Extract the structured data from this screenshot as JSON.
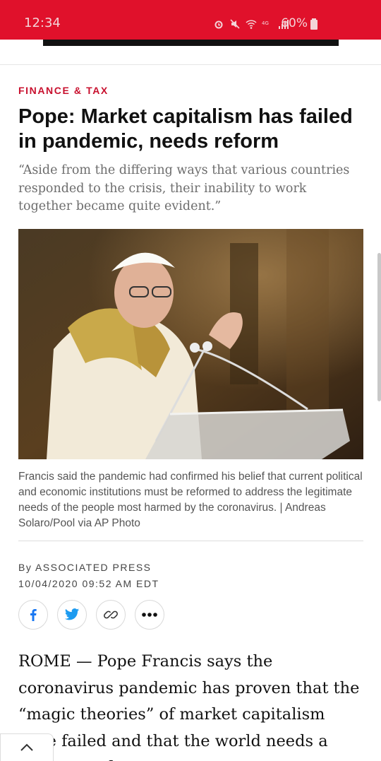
{
  "status_bar": {
    "time": "12:34",
    "battery": "60%",
    "icons": [
      "alarm-icon",
      "mute-icon",
      "wifi-icon",
      "lte-icon",
      "signal-icon",
      "battery-icon"
    ],
    "color": "#e0112b"
  },
  "article": {
    "category": "FINANCE & TAX",
    "headline": "Pope: Market capitalism has failed in pandemic, needs reform",
    "dek": "“Aside from the differing ways that various countries responded to the crisis, their inability to work together became quite evident.”",
    "photo_caption": "Francis said the pandemic had confirmed his belief that current political and economic institutions must be reformed to address the legitimate needs of the people most harmed by the coronavirus. | Andreas Solaro/Pool via AP Photo",
    "byline": "By ASSOCIATED PRESS",
    "timestamp": "10/04/2020 09:52 AM EDT",
    "body_first_lines": "ROME — Pope Francis says the coronavirus pandemic has proven that the “magic theories” of market capitalism have failed and that the world needs a new type of"
  },
  "share": {
    "buttons": [
      "facebook-icon",
      "twitter-icon",
      "link-icon",
      "more-icon"
    ],
    "facebook_color": "#1877f2",
    "twitter_color": "#1d9bf0"
  },
  "accent_color": "#c8102e"
}
